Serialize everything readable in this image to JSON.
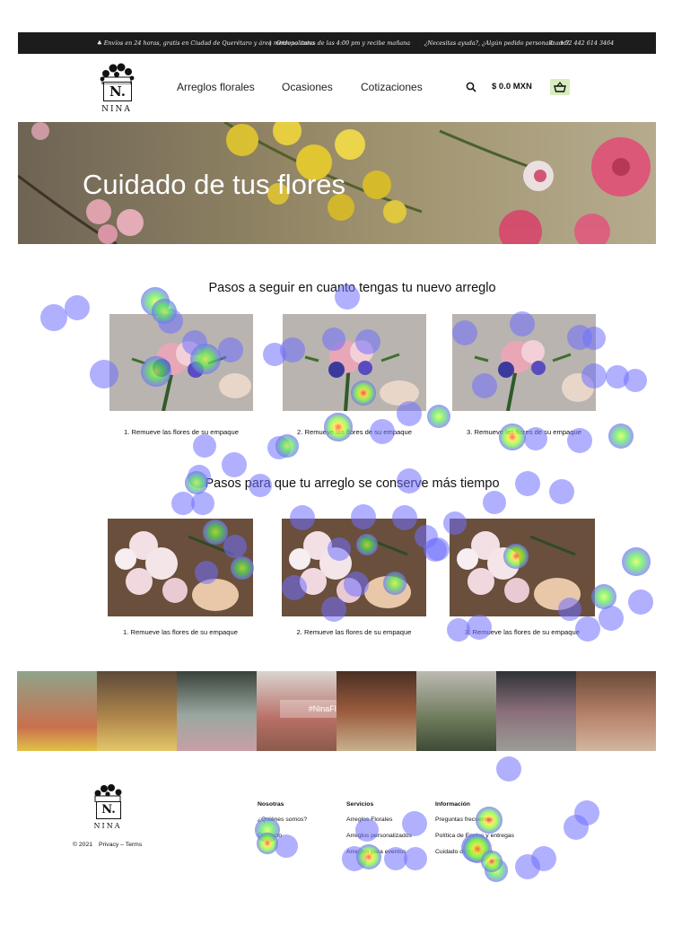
{
  "topbar": {
    "shipping": "Envíos en 24 horas, gratis en Ciudad de Querétaro y área metropolitana",
    "separator": "|",
    "order_before": "Ordena antes de las 4:00 pm y recibe mañana",
    "help": "¿Necesitas ayuda?, ¿Algún pedido personalizado?",
    "phone": "+52 442 614 3464"
  },
  "header": {
    "logo_letter": "N.",
    "logo_text": "NINA",
    "nav": [
      "Arreglos florales",
      "Ocasiones",
      "Cotizaciones"
    ],
    "cart_total": "$ 0.0 MXN"
  },
  "hero": {
    "title": "Cuidado de tus flores"
  },
  "section1": {
    "title": "Pasos a seguir en cuanto tengas tu nuevo arreglo",
    "captions": [
      "1. Remueve las flores de su empaque",
      "2. Remueve las flores de su empaque",
      "3. Remueve las flores de su empaque"
    ]
  },
  "section2": {
    "title": "Pasos para que tu arreglo se conserve más tiempo",
    "captions": [
      "1. Remueve las flores de su empaque",
      "2. Remueve las flores de su empaque",
      "3. Remueve las flores de su empaque"
    ]
  },
  "instagram": {
    "tag": "#NinaFlorería"
  },
  "footer": {
    "logo_letter": "N.",
    "logo_text": "NINA",
    "copyright": "© 2021",
    "privacy": "Privacy – Terms",
    "col1": {
      "heading": "Nosotras",
      "links": [
        "¿Quiénes somos?",
        "Contacto"
      ]
    },
    "col2": {
      "heading": "Servicios",
      "links": [
        "Arreglos Florales",
        "Arreglos personalizados",
        "Arreglos para eventos"
      ]
    },
    "col3": {
      "heading": "Información",
      "links": [
        "Preguntas frecuentes",
        "Política de Envíos y entregas",
        "Cuidado de tus flores"
      ]
    }
  },
  "colors": {
    "topbar_bg": "#1c1c1c",
    "cart_badge": "#d8ecc0",
    "heat_cold": "#6f6fff",
    "heat_warm": "#7cff3a",
    "heat_hot": "#ff3a1e"
  }
}
